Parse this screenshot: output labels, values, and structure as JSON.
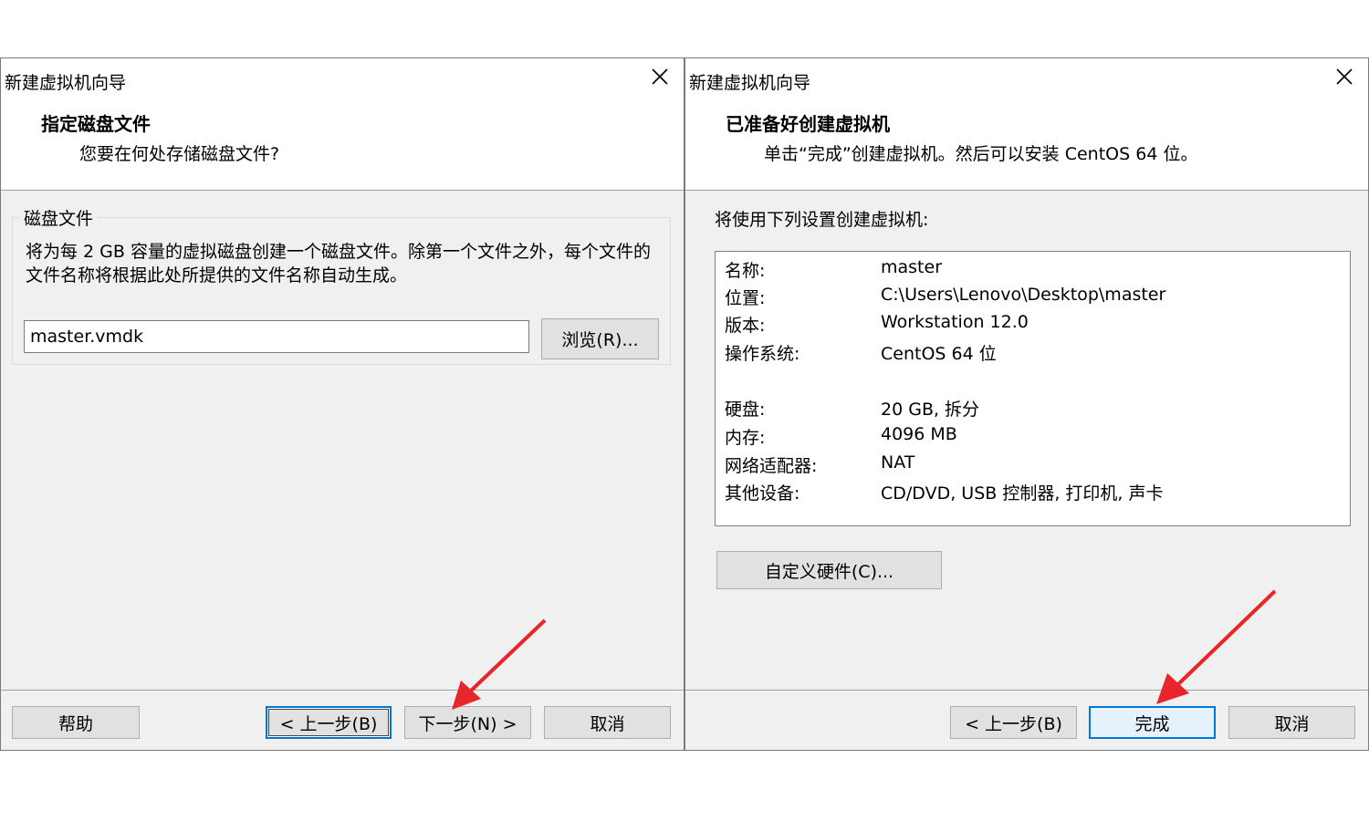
{
  "left_dialog": {
    "title": "新建虚拟机向导",
    "heading": "指定磁盘文件",
    "subheading": "您要在何处存储磁盘文件?",
    "group_label": "磁盘文件",
    "description": "将为每 2 GB 容量的虚拟磁盘创建一个磁盘文件。除第一个文件之外，每个文件的文件名称将根据此处所提供的文件名称自动生成。",
    "file_value": "master.vmdk",
    "browse_label": "浏览(R)...",
    "help_label": "帮助",
    "back_label": "< 上一步(B)",
    "next_label": "下一步(N) >",
    "cancel_label": "取消"
  },
  "right_dialog": {
    "title": "新建虚拟机向导",
    "heading": "已准备好创建虚拟机",
    "subheading": "单击“完成”创建虚拟机。然后可以安装 CentOS 64 位。",
    "intro": "将使用下列设置创建虚拟机:",
    "settings": [
      {
        "key": "名称:",
        "value": "master"
      },
      {
        "key": "位置:",
        "value": "C:\\Users\\Lenovo\\Desktop\\master"
      },
      {
        "key": "版本:",
        "value": "Workstation 12.0"
      },
      {
        "key": "操作系统:",
        "value": "CentOS 64 位"
      },
      {
        "key": "硬盘:",
        "value": "20 GB, 拆分"
      },
      {
        "key": "内存:",
        "value": "4096 MB"
      },
      {
        "key": "网络适配器:",
        "value": "NAT"
      },
      {
        "key": "其他设备:",
        "value": "CD/DVD, USB 控制器, 打印机, 声卡"
      }
    ],
    "customize_label": "自定义硬件(C)...",
    "back_label": "< 上一步(B)",
    "finish_label": "完成",
    "cancel_label": "取消"
  },
  "colors": {
    "dialog_bg": "#f0f0f0",
    "accent": "#0078d7",
    "annotation_arrow": "#e8262a"
  }
}
